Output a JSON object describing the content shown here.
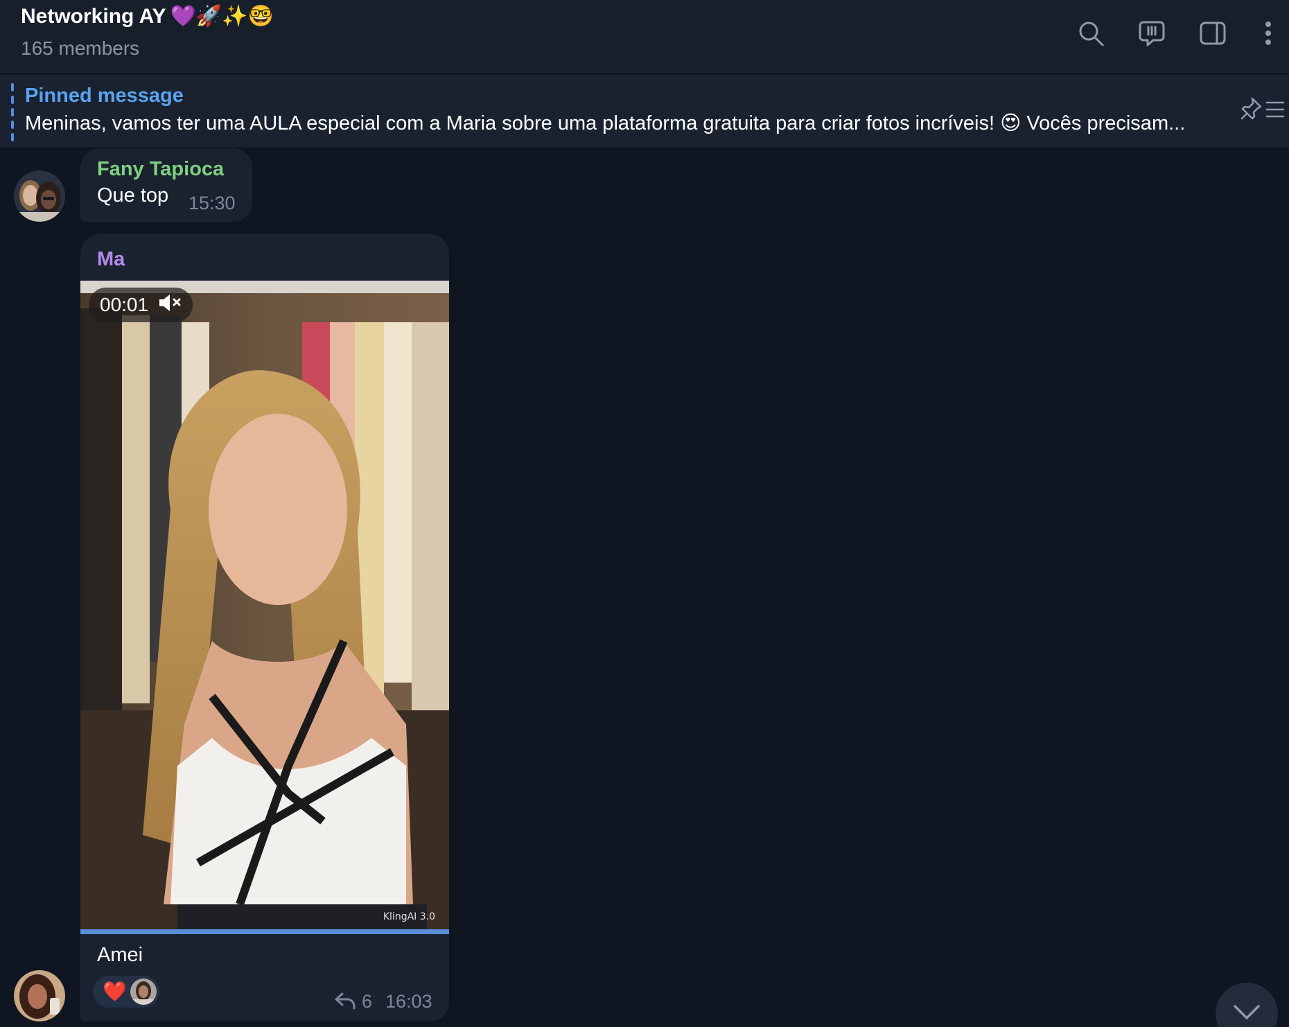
{
  "header": {
    "title": "Networking AY",
    "title_emojis": "💜🚀✨🤓",
    "subtitle": "165 members",
    "icons": [
      "search-icon",
      "discussion-icon",
      "sidebar-toggle-icon",
      "more-vertical-icon"
    ]
  },
  "pinned": {
    "label": "Pinned message",
    "text": "Meninas, vamos ter uma AULA especial com a Maria  sobre uma plataforma gratuita para criar fotos incríveis! 😍  Vocês precisam...",
    "icon": "pinned-list-icon"
  },
  "messages": [
    {
      "sender": "Fany Tapioca",
      "sender_color": "#7fd17f",
      "text": "Que top",
      "time": "15:30"
    },
    {
      "sender": "Ma",
      "sender_color": "#b588f0",
      "video_time": "00:01",
      "video_muted": true,
      "watermark": "KlingAI 3.0",
      "video_progress_fraction": 1.0,
      "text": "Amei",
      "reaction": "❤️",
      "reply_count": "6",
      "time": "16:03"
    }
  ],
  "colors": {
    "background": "#0f1521",
    "header_bg": "#171f2b",
    "bubble_bg": "#1a2230",
    "accent": "#5aa3f0"
  }
}
